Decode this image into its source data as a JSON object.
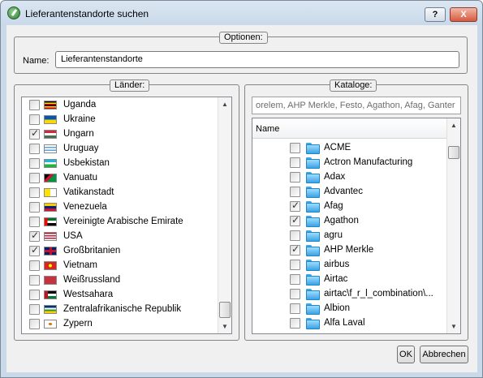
{
  "window": {
    "title": "Lieferantenstandorte suchen",
    "help": "?",
    "close": "X"
  },
  "options": {
    "legend": "Optionen:",
    "name_label": "Name:",
    "name_value": "Lieferantenstandorte"
  },
  "laender": {
    "legend": "Länder:",
    "items": [
      {
        "label": "Uganda",
        "checked": false
      },
      {
        "label": "Ukraine",
        "checked": false
      },
      {
        "label": "Ungarn",
        "checked": true
      },
      {
        "label": "Uruguay",
        "checked": false
      },
      {
        "label": "Usbekistan",
        "checked": false
      },
      {
        "label": "Vanuatu",
        "checked": false
      },
      {
        "label": "Vatikanstadt",
        "checked": false
      },
      {
        "label": "Venezuela",
        "checked": false
      },
      {
        "label": "Vereinigte Arabische Emirate",
        "checked": false
      },
      {
        "label": "USA",
        "checked": true
      },
      {
        "label": "Großbritanien",
        "checked": true
      },
      {
        "label": "Vietnam",
        "checked": false
      },
      {
        "label": "Weißrussland",
        "checked": false
      },
      {
        "label": "Westsahara",
        "checked": false
      },
      {
        "label": "Zentralafrikanische Republik",
        "checked": false
      },
      {
        "label": "Zypern",
        "checked": false
      }
    ]
  },
  "kataloge": {
    "legend": "Kataloge:",
    "filter_text": "orelem, AHP Merkle, Festo, Agathon, Afag, Ganter",
    "column_header": "Name",
    "items": [
      {
        "label": "ACME",
        "checked": false
      },
      {
        "label": "Actron Manufacturing",
        "checked": false
      },
      {
        "label": "Adax",
        "checked": false
      },
      {
        "label": "Advantec",
        "checked": false
      },
      {
        "label": "Afag",
        "checked": true
      },
      {
        "label": "Agathon",
        "checked": true
      },
      {
        "label": "agru",
        "checked": false
      },
      {
        "label": "AHP Merkle",
        "checked": true
      },
      {
        "label": "airbus",
        "checked": false
      },
      {
        "label": "Airtac",
        "checked": false
      },
      {
        "label": "airtac\\f_r_l_combination\\...",
        "checked": false
      },
      {
        "label": "Albion",
        "checked": false
      },
      {
        "label": "Alfa Laval",
        "checked": false
      }
    ]
  },
  "buttons": {
    "ok": "OK",
    "cancel": "Abbrechen"
  }
}
